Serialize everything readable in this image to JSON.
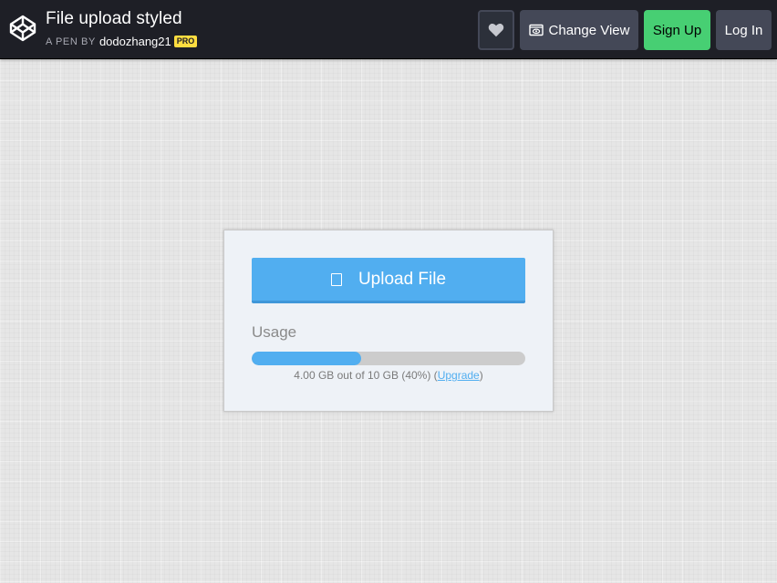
{
  "header": {
    "title": "File upload styled",
    "byline_prefix": "A PEN BY",
    "author": "dodozhang21",
    "badge": "PRO",
    "buttons": {
      "change_view": "Change View",
      "sign_up": "Sign Up",
      "log_in": "Log In"
    },
    "icons": {
      "logo": "codepen-logo-icon",
      "heart": "heart-icon",
      "change_view": "eye-icon"
    },
    "colors": {
      "bg": "#1e1f26",
      "button_dark": "#444857",
      "sign_up": "#47cf73",
      "badge": "#ffdd40"
    }
  },
  "upload": {
    "button_label": "Upload File",
    "icon": "file-icon",
    "usage_label": "Usage",
    "usage_fraction": 0.4,
    "usage_pre": "4.00 GB out of 10 GB (40%) (",
    "upgrade_link": "Upgrade",
    "usage_post": ")",
    "accent_color": "#51aef0"
  }
}
